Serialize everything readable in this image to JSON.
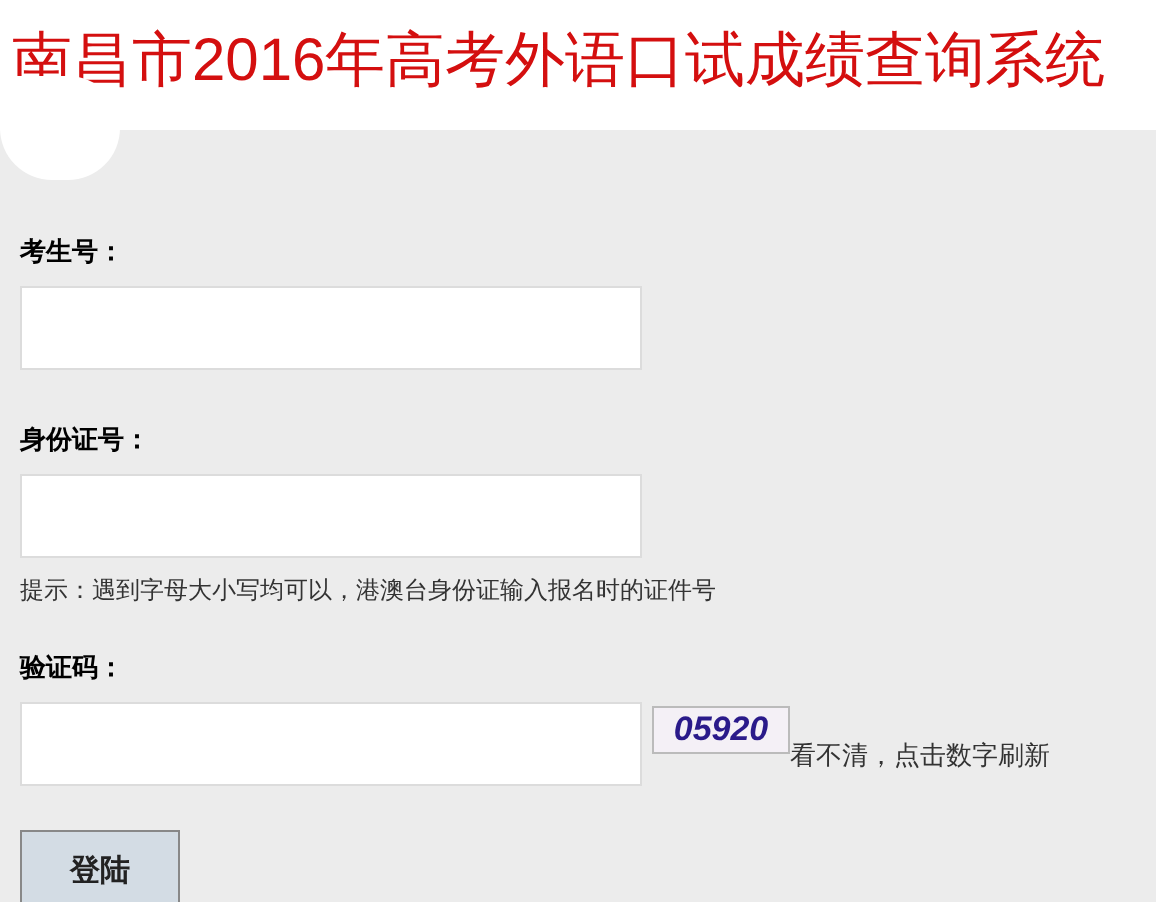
{
  "header": {
    "title": "南昌市2016年高考外语口试成绩查询系统"
  },
  "form": {
    "fields": [
      {
        "kind": "text",
        "label": "考生号："
      },
      {
        "kind": "text",
        "label": "身份证号：",
        "hint": "提示：遇到字母大小写均可以，港澳台身份证输入报名时的证件号"
      },
      {
        "kind": "captcha",
        "label": "验证码：",
        "captcha": "05920",
        "refresh_text": "看不清，点击数字刷新"
      }
    ],
    "submit": "登陆"
  }
}
